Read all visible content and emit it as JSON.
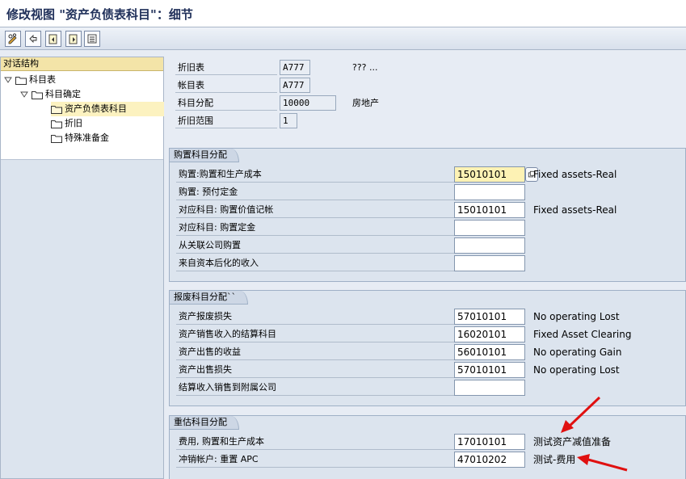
{
  "window": {
    "title": "修改视图 \"资产负债表科目\"：细节"
  },
  "toolbar": {
    "buttons": [
      {
        "icon": "pencil-glasses-icon"
      },
      {
        "icon": "undo-icon"
      },
      {
        "icon": "previous-entry-icon"
      },
      {
        "icon": "next-entry-icon"
      },
      {
        "icon": "list-icon"
      }
    ]
  },
  "tree": {
    "header": "对话结构",
    "nodes": [
      {
        "label": "科目表",
        "expanded": true
      },
      {
        "label": "科目确定",
        "expanded": true
      },
      {
        "label": "资产负债表科目",
        "selected": true
      },
      {
        "label": "折旧"
      },
      {
        "label": "特殊准备金"
      }
    ]
  },
  "header": {
    "fields": [
      {
        "label": "折旧表",
        "value": "A777",
        "desc": "??? ..."
      },
      {
        "label": "帐目表",
        "value": "A777",
        "desc": ""
      },
      {
        "label": "科目分配",
        "value": "10000",
        "desc": "房地产"
      },
      {
        "label": "折旧范围",
        "value": "1",
        "desc": ""
      }
    ]
  },
  "groups": [
    {
      "title": "购置科目分配",
      "rows": [
        {
          "label": "购置:购置和生产成本",
          "value": "15010101",
          "desc": "Fixed assets-Real"
        },
        {
          "label": "购置: 预付定金",
          "value": "",
          "desc": ""
        },
        {
          "label": "对应科目: 购置价值记帐",
          "value": "15010101",
          "desc": "Fixed assets-Real"
        },
        {
          "label": "对应科目: 购置定金",
          "value": "",
          "desc": ""
        },
        {
          "label": "从关联公司购置",
          "value": "",
          "desc": ""
        },
        {
          "label": "来自资本后化的收入",
          "value": "",
          "desc": ""
        }
      ]
    },
    {
      "title": "报废科目分配``",
      "rows": [
        {
          "label": "资产报废损失",
          "value": "57010101",
          "desc": "No operating Lost"
        },
        {
          "label": "资产销售收入的结算科目",
          "value": "16020101",
          "desc": "Fixed Asset Clearing"
        },
        {
          "label": "资产出售的收益",
          "value": "56010101",
          "desc": "No operating Gain"
        },
        {
          "label": "资产出售损失",
          "value": "57010101",
          "desc": "No operating Lost"
        },
        {
          "label": "结算收入销售到附属公司",
          "value": "",
          "desc": ""
        }
      ]
    },
    {
      "title": "重估科目分配",
      "rows": [
        {
          "label": "费用, 购置和生产成本",
          "value": "17010101",
          "desc": "测试资产减值准备"
        },
        {
          "label": "冲销帐户: 重置 APC",
          "value": "47010202",
          "desc": "测试-费用"
        }
      ]
    }
  ],
  "colors": {
    "annotation_arrow": "#e01010",
    "active_field": "#fdf2b4"
  }
}
